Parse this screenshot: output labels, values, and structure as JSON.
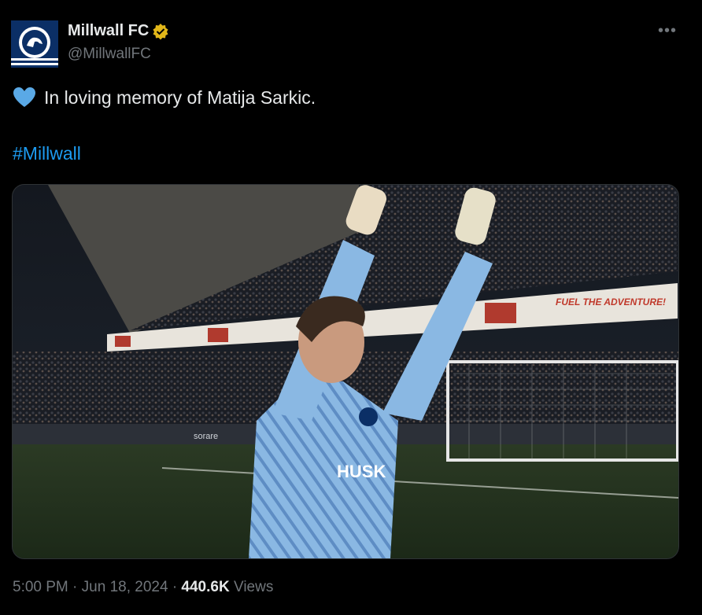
{
  "author": {
    "display_name": "Millwall FC",
    "handle": "@MillwallFC"
  },
  "tweet": {
    "text": "In loving memory of Matija Sarkic.",
    "hashtag": "#Millwall",
    "heart_color": "#5aa9e6"
  },
  "media": {
    "banner_text": "FUEL THE ADVENTURE!",
    "board_text": "sorare",
    "shirt_text": "HUSK"
  },
  "meta": {
    "time": "5:00 PM",
    "date": "Jun 18, 2024",
    "views_count": "440.6K",
    "views_label": "Views",
    "separator": "·"
  },
  "colors": {
    "accent": "#1d9bf0",
    "verified": "#e2b719",
    "kit": "#8ab8e3"
  }
}
